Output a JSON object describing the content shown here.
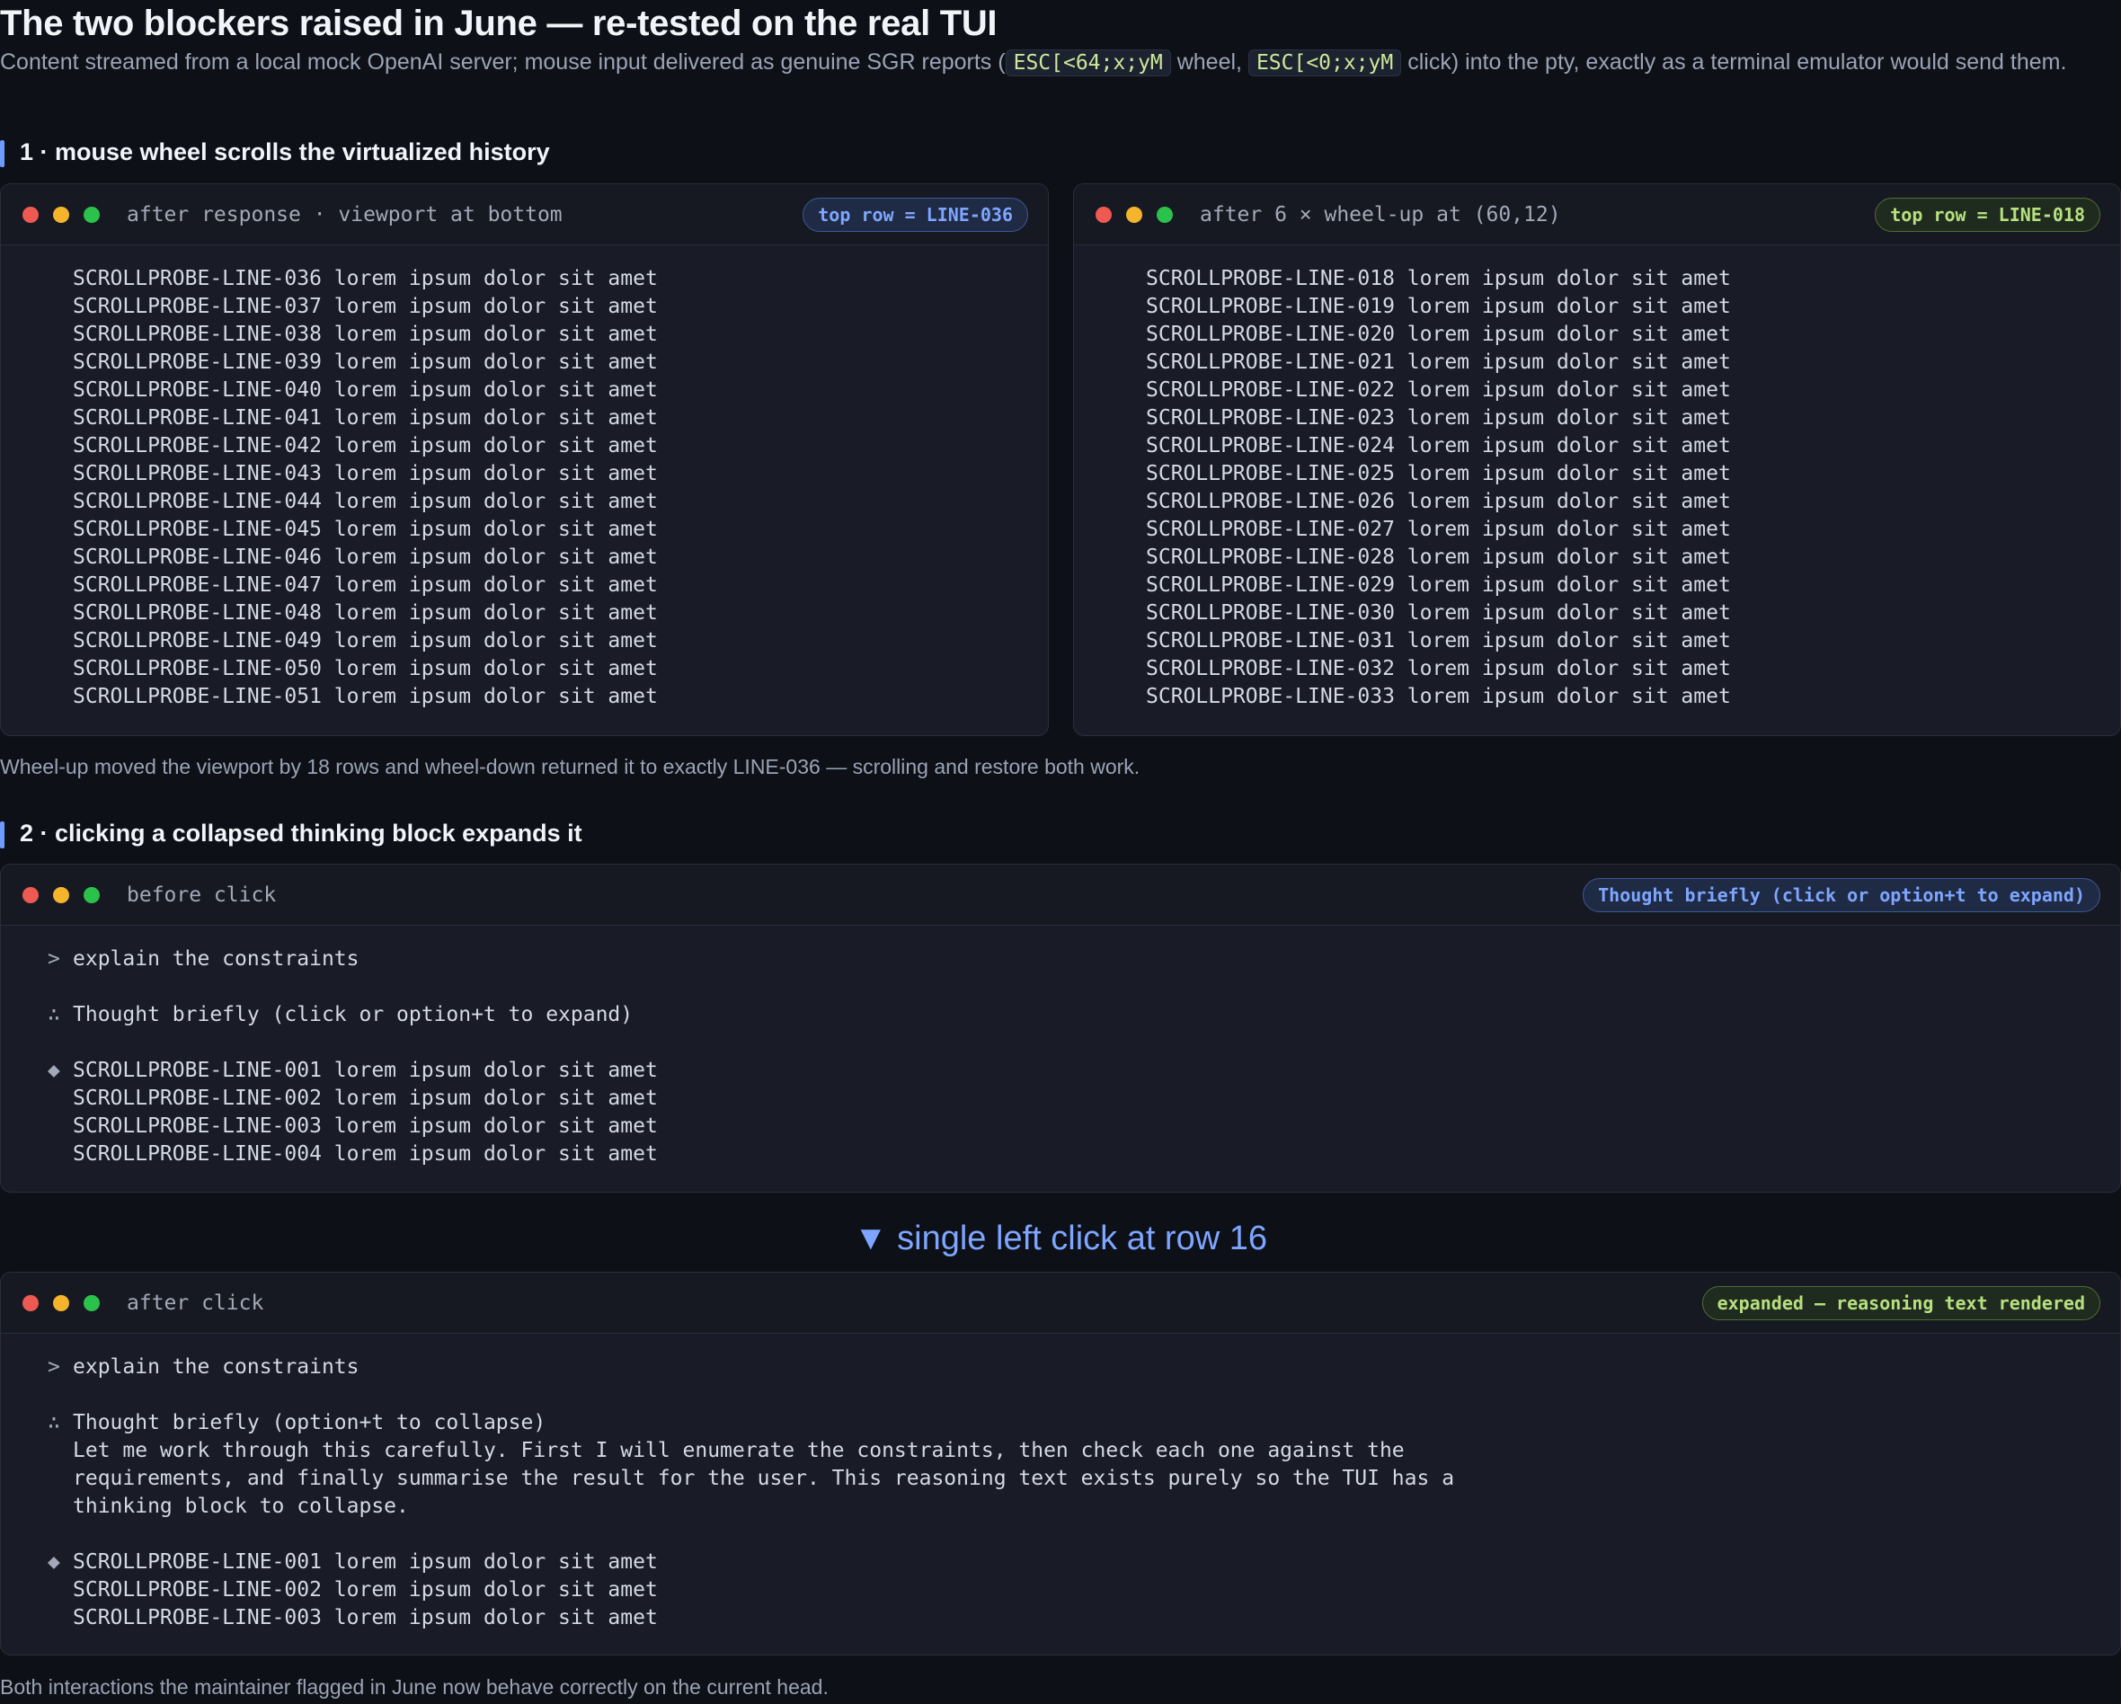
{
  "header": {
    "title": "The two blockers raised in June — re-tested on the real TUI",
    "subtitle_parts": {
      "a": "Content streamed from a local mock OpenAI server; mouse input delivered as genuine SGR reports (",
      "code1": "ESC[<64;x;yM",
      "b": " wheel, ",
      "code2": "ESC[<0;x;yM",
      "c": " click) into the pty, exactly as a terminal emulator would send them."
    }
  },
  "section1": {
    "heading": "1 · mouse wheel scrolls the virtualized history",
    "left": {
      "label": "after response · viewport at bottom",
      "badge": "top row = LINE-036",
      "lines": [
        "SCROLLPROBE-LINE-036 lorem ipsum dolor sit amet",
        "SCROLLPROBE-LINE-037 lorem ipsum dolor sit amet",
        "SCROLLPROBE-LINE-038 lorem ipsum dolor sit amet",
        "SCROLLPROBE-LINE-039 lorem ipsum dolor sit amet",
        "SCROLLPROBE-LINE-040 lorem ipsum dolor sit amet",
        "SCROLLPROBE-LINE-041 lorem ipsum dolor sit amet",
        "SCROLLPROBE-LINE-042 lorem ipsum dolor sit amet",
        "SCROLLPROBE-LINE-043 lorem ipsum dolor sit amet",
        "SCROLLPROBE-LINE-044 lorem ipsum dolor sit amet",
        "SCROLLPROBE-LINE-045 lorem ipsum dolor sit amet",
        "SCROLLPROBE-LINE-046 lorem ipsum dolor sit amet",
        "SCROLLPROBE-LINE-047 lorem ipsum dolor sit amet",
        "SCROLLPROBE-LINE-048 lorem ipsum dolor sit amet",
        "SCROLLPROBE-LINE-049 lorem ipsum dolor sit amet",
        "SCROLLPROBE-LINE-050 lorem ipsum dolor sit amet",
        "SCROLLPROBE-LINE-051 lorem ipsum dolor sit amet"
      ]
    },
    "right": {
      "label": "after 6 × wheel-up at (60,12)",
      "badge": "top row = LINE-018",
      "lines": [
        "SCROLLPROBE-LINE-018 lorem ipsum dolor sit amet",
        "SCROLLPROBE-LINE-019 lorem ipsum dolor sit amet",
        "SCROLLPROBE-LINE-020 lorem ipsum dolor sit amet",
        "SCROLLPROBE-LINE-021 lorem ipsum dolor sit amet",
        "SCROLLPROBE-LINE-022 lorem ipsum dolor sit amet",
        "SCROLLPROBE-LINE-023 lorem ipsum dolor sit amet",
        "SCROLLPROBE-LINE-024 lorem ipsum dolor sit amet",
        "SCROLLPROBE-LINE-025 lorem ipsum dolor sit amet",
        "SCROLLPROBE-LINE-026 lorem ipsum dolor sit amet",
        "SCROLLPROBE-LINE-027 lorem ipsum dolor sit amet",
        "SCROLLPROBE-LINE-028 lorem ipsum dolor sit amet",
        "SCROLLPROBE-LINE-029 lorem ipsum dolor sit amet",
        "SCROLLPROBE-LINE-030 lorem ipsum dolor sit amet",
        "SCROLLPROBE-LINE-031 lorem ipsum dolor sit amet",
        "SCROLLPROBE-LINE-032 lorem ipsum dolor sit amet",
        "SCROLLPROBE-LINE-033 lorem ipsum dolor sit amet"
      ]
    },
    "caption": "Wheel-up moved the viewport by 18 rows and wheel-down returned it to exactly LINE-036 — scrolling and restore both work."
  },
  "section2": {
    "heading": "2 · clicking a collapsed thinking block expands it",
    "before": {
      "label": "before click",
      "badge": "Thought briefly (click or option+t to expand)",
      "lines": [
        {
          "m": ">",
          "t": "explain the constraints"
        },
        {
          "m": "",
          "t": ""
        },
        {
          "m": "∴",
          "t": "Thought briefly (click or option+t to expand)"
        },
        {
          "m": "",
          "t": ""
        },
        {
          "m": "◆",
          "t": "SCROLLPROBE-LINE-001 lorem ipsum dolor sit amet"
        },
        {
          "m": "",
          "t": "SCROLLPROBE-LINE-002 lorem ipsum dolor sit amet"
        },
        {
          "m": "",
          "t": "SCROLLPROBE-LINE-003 lorem ipsum dolor sit amet"
        },
        {
          "m": "",
          "t": "SCROLLPROBE-LINE-004 lorem ipsum dolor sit amet"
        }
      ]
    },
    "arrow": "▼ single left click at row 16",
    "after": {
      "label": "after click",
      "badge": "expanded — reasoning text rendered",
      "lines": [
        {
          "m": ">",
          "t": "explain the constraints"
        },
        {
          "m": "",
          "t": ""
        },
        {
          "m": "∴",
          "t": "Thought briefly (option+t to collapse)"
        },
        {
          "m": "",
          "t": "Let me work through this carefully. First I will enumerate the constraints, then check each one against the"
        },
        {
          "m": "",
          "t": "requirements, and finally summarise the result for the user. This reasoning text exists purely so the TUI has a"
        },
        {
          "m": "",
          "t": "thinking block to collapse."
        },
        {
          "m": "",
          "t": ""
        },
        {
          "m": "◆",
          "t": "SCROLLPROBE-LINE-001 lorem ipsum dolor sit amet"
        },
        {
          "m": "",
          "t": "SCROLLPROBE-LINE-002 lorem ipsum dolor sit amet"
        },
        {
          "m": "",
          "t": "SCROLLPROBE-LINE-003 lorem ipsum dolor sit amet"
        }
      ]
    },
    "caption": "Both interactions the maintainer flagged in June now behave correctly on the current head."
  }
}
